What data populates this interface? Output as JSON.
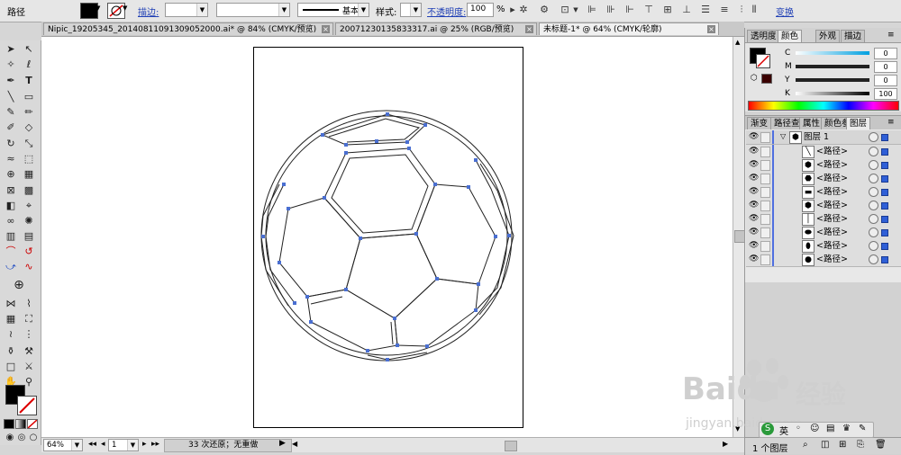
{
  "control_bar": {
    "object_label": "路径",
    "stroke_label": "描边:",
    "stroke_style": "基本",
    "style_label": "样式:",
    "opacity_label": "不透明度:",
    "opacity_value": "100",
    "opacity_unit": "%",
    "transform_label": "变换"
  },
  "doc_tabs": [
    {
      "label": "Nipic_19205345_20140811091309052000.ai* @ 84% (CMYK/预览)"
    },
    {
      "label": "20071230135833317.ai @ 25% (RGB/预览)"
    },
    {
      "label": "未标题-1* @ 64% (CMYK/轮廓)"
    }
  ],
  "color_panel": {
    "tabs": [
      "透明度",
      "颜色",
      "外观",
      "描边"
    ],
    "channels": [
      {
        "key": "C",
        "value": "0"
      },
      {
        "key": "M",
        "value": "0"
      },
      {
        "key": "Y",
        "value": "0"
      },
      {
        "key": "K",
        "value": "100"
      }
    ]
  },
  "layers_panel": {
    "tabs": [
      "渐变",
      "路径查",
      "属性",
      "颜色参",
      "图层"
    ],
    "layer_name": "图层 1",
    "rows": [
      {
        "label": "<路径>"
      },
      {
        "label": "<路径>"
      },
      {
        "label": "<路径>"
      },
      {
        "label": "<路径>"
      },
      {
        "label": "<路径>"
      },
      {
        "label": "<路径>"
      },
      {
        "label": "<路径>"
      },
      {
        "label": "<路径>"
      },
      {
        "label": "<路径>"
      }
    ],
    "count_label": "1 个图层"
  },
  "status_bar": {
    "zoom": "64%",
    "page": "1",
    "history": "33 次还原；无重做"
  },
  "watermark": {
    "brand": "Baidu",
    "cn": "经验",
    "url": "jingyan.baidu.com"
  },
  "colors": {
    "link": "#1f3fb5",
    "anchor": "#4a6fd1",
    "selection": "#2f5fd7"
  }
}
